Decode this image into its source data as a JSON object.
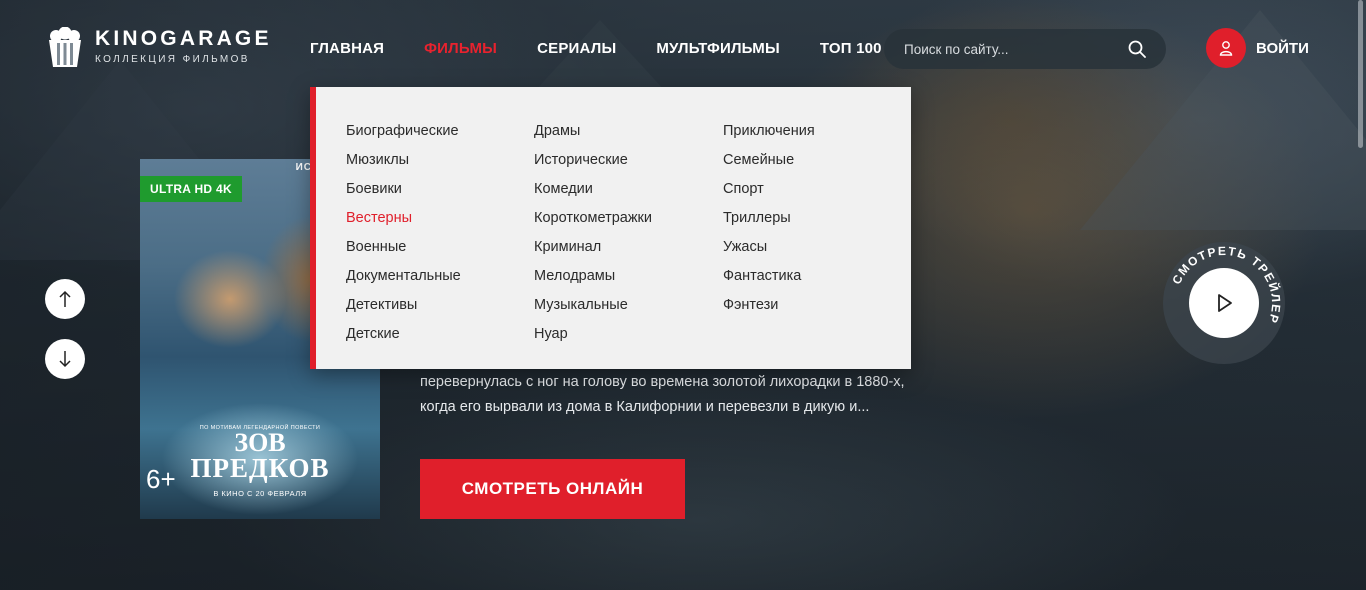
{
  "brand": {
    "title": "KINOGARAGE",
    "subtitle": "КОЛЛЕКЦИЯ ФИЛЬМОВ"
  },
  "nav": {
    "items": [
      {
        "label": "ГЛАВНАЯ",
        "active": false
      },
      {
        "label": "ФИЛЬМЫ",
        "active": true
      },
      {
        "label": "СЕРИАЛЫ",
        "active": false
      },
      {
        "label": "МУЛЬТФИЛЬМЫ",
        "active": false
      },
      {
        "label": "ТОП 100",
        "active": false
      }
    ]
  },
  "search": {
    "placeholder": "Поиск по сайту...",
    "icon": "search-icon"
  },
  "login": {
    "label": "ВОЙТИ",
    "icon": "user-icon"
  },
  "dropdown": {
    "columns": [
      [
        "Биографические",
        "Мюзиклы",
        "Боевики",
        "Вестерны",
        "Военные",
        "Документальные",
        "Детективы",
        "Детские"
      ],
      [
        "Драмы",
        "Исторические",
        "Комедии",
        "Короткометражки",
        "Криминал",
        "Мелодрамы",
        "Музыкальные",
        "Нуар"
      ],
      [
        "Приключения",
        "Семейные",
        "Спорт",
        "Триллеры",
        "Ужасы",
        "Фантастика",
        "Фэнтези"
      ]
    ],
    "active_item": "Вестерны"
  },
  "poster": {
    "badge": "ULTRA HD 4K",
    "top_text": "ИСОН ФОРД",
    "subtitle": "ПО МОТИВАМ ЛЕГЕНДАРНОЙ ПОВЕСТИ",
    "title_line1": "ЗОВ",
    "title_line2": "ПРЕДКОВ",
    "release": "В КИНО С 20 ФЕВРАЛЯ",
    "age": "6+"
  },
  "description": {
    "line1": "перевернулась с ног на голову во времена золотой лихорадки в 1880-х,",
    "line2": "когда его вырвали из дома в Калифорнии и перевезли в дикую и..."
  },
  "watch_button": {
    "label": "СМОТРЕТЬ ОНЛАЙН"
  },
  "trailer": {
    "label": "СМОТРЕТЬ ТРЕЙЛЕР",
    "icon": "play-icon"
  },
  "colors": {
    "accent": "#e01f2b",
    "badge_green": "#1f9b2e",
    "dropdown_bg": "#f1f1f1"
  }
}
